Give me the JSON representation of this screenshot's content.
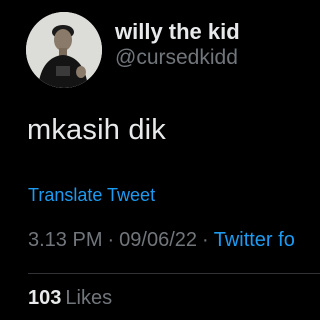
{
  "author": {
    "display_name": "willy the kid",
    "handle": "@cursedkidd",
    "avatar_icon": "profile-photo"
  },
  "tweet": {
    "text": "mkasih dik",
    "translate_label": "Translate Tweet",
    "time": "3.13 PM",
    "separator": "·",
    "date": "09/06/22",
    "source": "Twitter fo"
  },
  "stats": {
    "likes_count": "103",
    "likes_label": "Likes"
  },
  "colors": {
    "background": "#000000",
    "primary_text": "#e7e9ea",
    "secondary_text": "#71767b",
    "link": "#1d9bf0"
  }
}
